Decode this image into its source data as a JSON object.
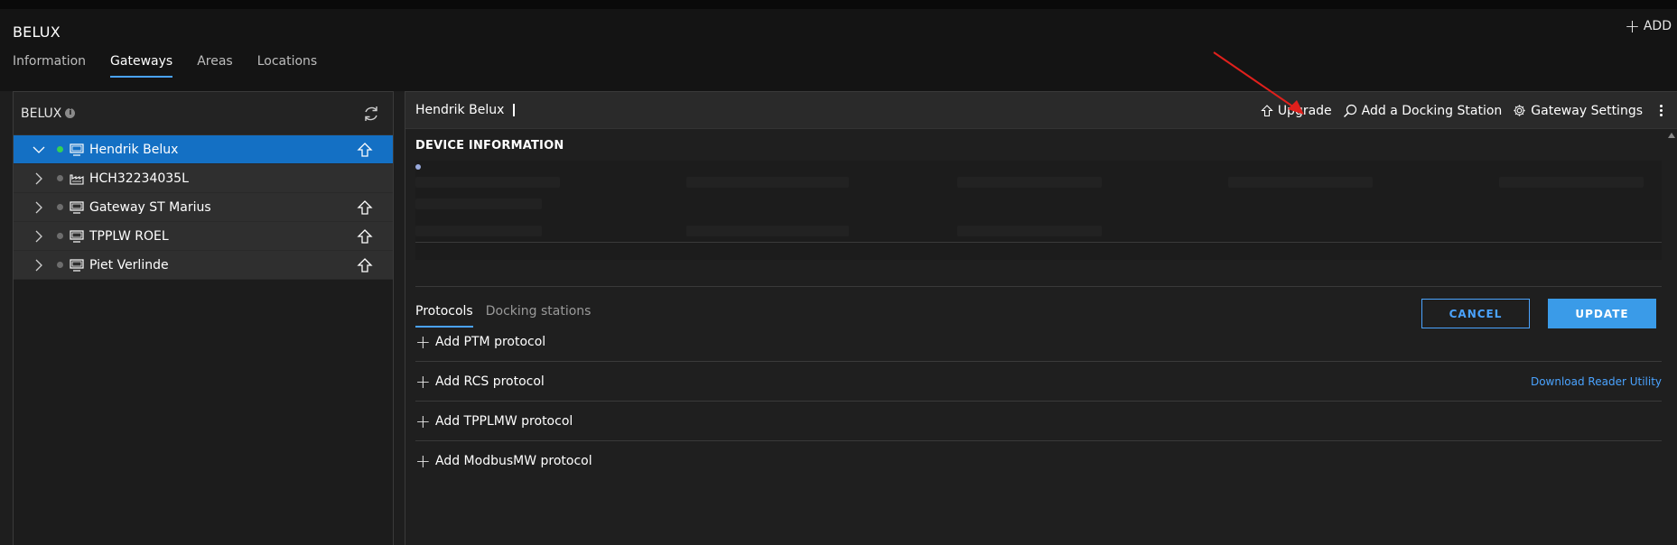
{
  "header": {
    "org_title": "BELUX",
    "add_label": "ADD",
    "tabs": [
      {
        "label": "Information",
        "active": false
      },
      {
        "label": "Gateways",
        "active": true
      },
      {
        "label": "Areas",
        "active": false
      },
      {
        "label": "Locations",
        "active": false
      }
    ]
  },
  "sidebar": {
    "title": "BELUX",
    "info_glyph": "i",
    "refresh_icon": "refresh-icon",
    "items": [
      {
        "label": "Hendrik Belux",
        "status": "online",
        "icon": "monitor-icon",
        "upgrade": true,
        "selected": true,
        "expanded": true
      },
      {
        "label": "HCH32234035L",
        "status": "offline",
        "icon": "factory-icon",
        "upgrade": false,
        "selected": false,
        "expanded": false
      },
      {
        "label": "Gateway ST Marius",
        "status": "offline",
        "icon": "monitor-icon",
        "upgrade": true,
        "selected": false,
        "expanded": false
      },
      {
        "label": "TPPLW ROEL",
        "status": "offline",
        "icon": "monitor-icon",
        "upgrade": true,
        "selected": false,
        "expanded": false
      },
      {
        "label": "Piet Verlinde",
        "status": "offline",
        "icon": "monitor-icon",
        "upgrade": true,
        "selected": false,
        "expanded": false
      }
    ]
  },
  "detail": {
    "gateway_name": "Hendrik Belux",
    "actions": {
      "upgrade": "Upgrade",
      "add_docking": "Add a Docking Station",
      "settings": "Gateway Settings"
    },
    "section_title": "DEVICE INFORMATION",
    "cancel_label": "CANCEL",
    "update_label": "UPDATE",
    "sub_tabs": [
      {
        "label": "Protocols",
        "active": true
      },
      {
        "label": "Docking stations",
        "active": false
      }
    ],
    "protocols": [
      {
        "label": "Add PTM protocol"
      },
      {
        "label": "Add RCS protocol"
      },
      {
        "label": "Add TPPLMW protocol"
      },
      {
        "label": "Add ModbusMW protocol"
      }
    ],
    "download_link": "Download Reader Utility"
  },
  "colors": {
    "accent": "#4aa3ff",
    "selected_row": "#1470c4",
    "online": "#33d155",
    "annotation_arrow": "#e0201c"
  }
}
